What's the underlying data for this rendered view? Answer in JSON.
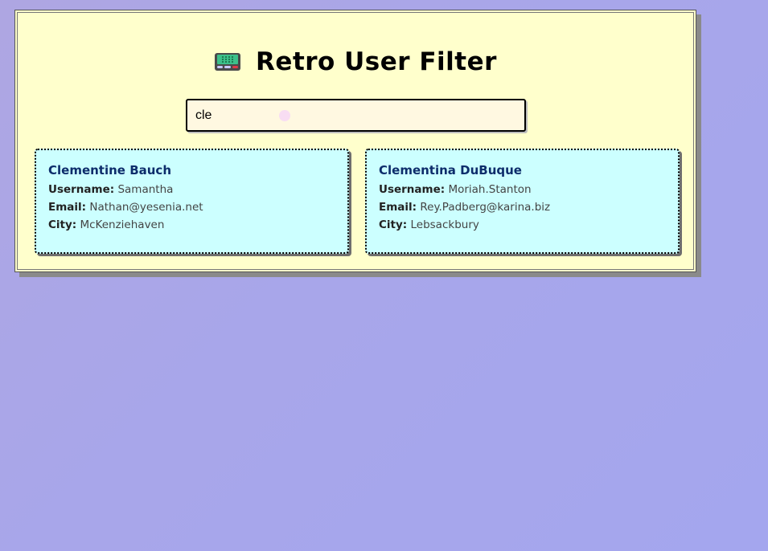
{
  "header": {
    "title": "Retro User Filter",
    "icon": "pager-icon"
  },
  "search": {
    "value": "cle",
    "placeholder": ""
  },
  "labels": {
    "username": "Username:",
    "email": "Email:",
    "city": "City:"
  },
  "users": [
    {
      "name": "Clementine Bauch",
      "username": "Samantha",
      "email": "Nathan@yesenia.net",
      "city": "McKenziehaven"
    },
    {
      "name": "Clementina DuBuque",
      "username": "Moriah.Stanton",
      "email": "Rey.Padberg@karina.biz",
      "city": "Lebsackbury"
    }
  ],
  "colors": {
    "panel_bg": "#ffffcc",
    "card_bg": "#ccffff",
    "name_color": "#0d2d6b",
    "input_bg": "#fff8e1"
  }
}
